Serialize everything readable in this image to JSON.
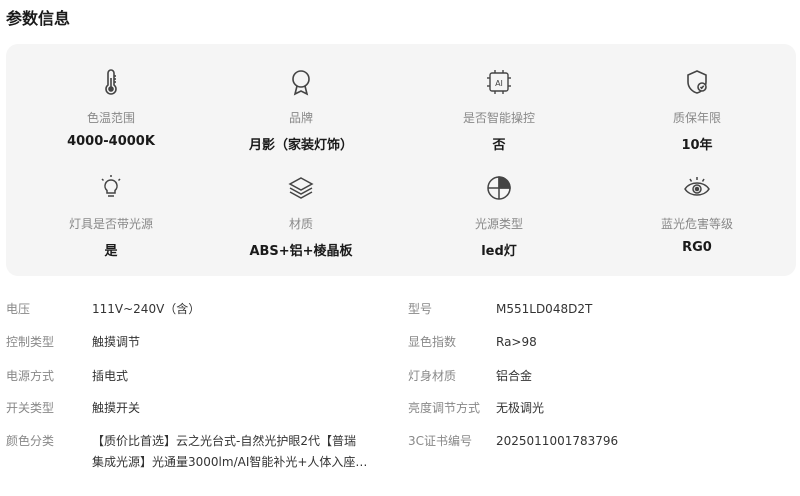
{
  "title": "参数信息",
  "highlights": [
    {
      "icon": "thermometer-icon",
      "label": "色温范围",
      "value": "4000-4000K"
    },
    {
      "icon": "award-icon",
      "label": "品牌",
      "value": "月影（家装灯饰）"
    },
    {
      "icon": "ai-chip-icon",
      "label": "是否智能操控",
      "value": "否"
    },
    {
      "icon": "warranty-shield-icon",
      "label": "质保年限",
      "value": "10年"
    },
    {
      "icon": "bulb-icon",
      "label": "灯具是否带光源",
      "value": "是"
    },
    {
      "icon": "layers-icon",
      "label": "材质",
      "value": "ABS+铝+棱晶板"
    },
    {
      "icon": "light-source-icon",
      "label": "光源类型",
      "value": "led灯"
    },
    {
      "icon": "eye-icon",
      "label": "蓝光危害等级",
      "value": "RG0"
    }
  ],
  "specs_left": [
    {
      "key": "电压",
      "value": "111V~240V（含）"
    },
    {
      "key": "控制类型",
      "value": "触摸调节"
    },
    {
      "key": "电源方式",
      "value": "插电式"
    },
    {
      "key": "开关类型",
      "value": "触摸开关"
    },
    {
      "key": "颜色分类",
      "value_line1": "【质价比首选】云之光台式-自然光护眼2代【普瑞",
      "value_line2": "集成光源】光通量3000lm/AI智能补光+人体入座…"
    }
  ],
  "specs_right": [
    {
      "key": "型号",
      "value": "M551LD048D2T"
    },
    {
      "key": "显色指数",
      "value": "Ra>98"
    },
    {
      "key": "灯身材质",
      "value": "铝合金"
    },
    {
      "key": "亮度调节方式",
      "value": "无极调光"
    },
    {
      "key": "3C证书编号",
      "value": "2025011001783796"
    }
  ]
}
